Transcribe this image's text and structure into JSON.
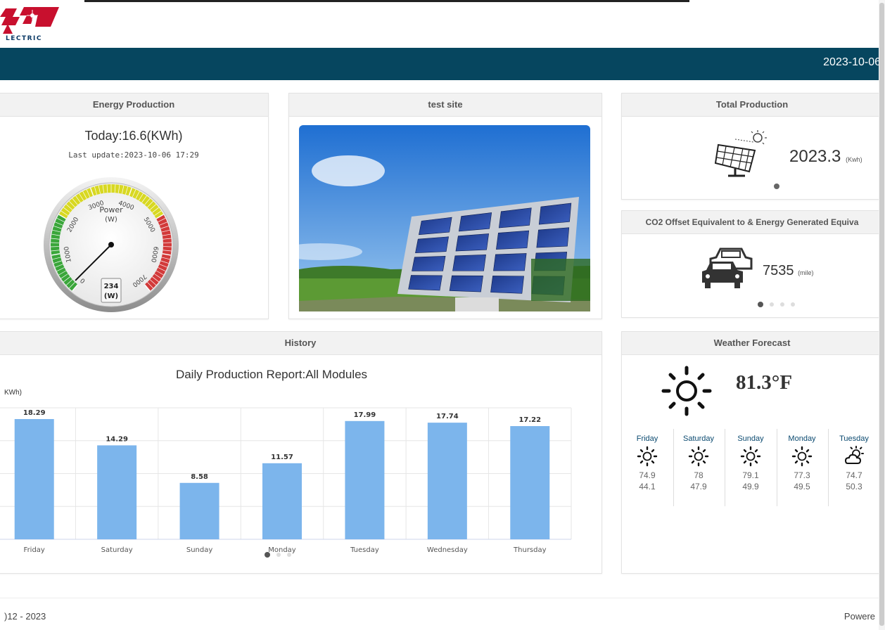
{
  "brand": {
    "logo_text": "LECTRIC",
    "accent": "#c8102e",
    "banner_color": "#06465f"
  },
  "header": {
    "date": "2023-10-06"
  },
  "energy_production": {
    "title": "Energy Production",
    "today": "Today:16.6(KWh)",
    "last_update": "Last update:2023-10-06 17:29",
    "gauge": {
      "label": "Power",
      "unit": "(W)",
      "ticks": [
        "0",
        "1000",
        "2000",
        "3000",
        "4000",
        "5000",
        "6000",
        "7000"
      ],
      "value": 234,
      "value_text": "234",
      "value_unit": "(W)",
      "max": 7000
    }
  },
  "site": {
    "title": "test site",
    "image": "solar-panel-photo"
  },
  "total_production": {
    "title": "Total Production",
    "value": "2023.3",
    "unit": "(Kwh)",
    "icon": "solar-panel-icon"
  },
  "co2": {
    "title": "CO2 Offset Equivalent to & Energy Generated Equiva",
    "value": "7535",
    "unit": "(mile)",
    "icon": "cars-icon"
  },
  "history": {
    "title": "History",
    "chart_title": "Daily Production Report:All Modules",
    "y_unit": "KWh)",
    "bar_color": "#7cb5ec"
  },
  "chart_data": {
    "type": "bar",
    "title": "Daily Production Report:All Modules",
    "ylabel": "KWh)",
    "categories": [
      "Friday",
      "Saturday",
      "Sunday",
      "Monday",
      "Tuesday",
      "Wednesday",
      "Thursday"
    ],
    "values": [
      18.29,
      14.29,
      8.58,
      11.57,
      17.99,
      17.74,
      17.22
    ],
    "labels": [
      "18.29",
      "14.29",
      "8.58",
      "11.57",
      "17.99",
      "17.74",
      "17.22"
    ],
    "ylim": [
      0,
      20
    ],
    "grid": true
  },
  "weather": {
    "title": "Weather Forecast",
    "current_temp": "81.3°F",
    "current_icon": "sun-icon",
    "days": [
      {
        "name": "Friday",
        "hi": "74.9",
        "lo": "44.1",
        "icon": "sun-icon"
      },
      {
        "name": "Saturday",
        "hi": "78",
        "lo": "47.9",
        "icon": "sun-icon"
      },
      {
        "name": "Sunday",
        "hi": "79.1",
        "lo": "49.9",
        "icon": "sun-icon"
      },
      {
        "name": "Monday",
        "hi": "77.3",
        "lo": "49.5",
        "icon": "sun-icon"
      },
      {
        "name": "Tuesday",
        "hi": "74.7",
        "lo": "50.3",
        "icon": "partly-cloudy-icon"
      }
    ]
  },
  "footer": {
    "copyright": ")12 - 2023",
    "powered": "Powere"
  }
}
